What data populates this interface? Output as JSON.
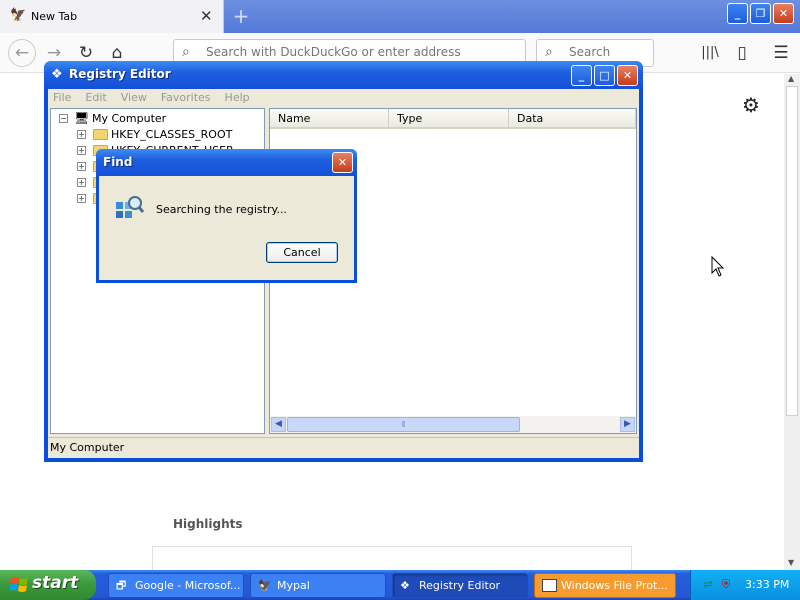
{
  "browser": {
    "tab": {
      "title": "New Tab",
      "close": "✕"
    },
    "new_tab": "+",
    "window_buttons": {
      "minimize": "_",
      "restore": "❐",
      "close": "✕"
    },
    "nav": {
      "back": "←",
      "forward": "→",
      "reload": "↻",
      "home": "⌂"
    },
    "address_placeholder": "Search with DuckDuckGo or enter address",
    "search_placeholder": "Search",
    "library": "|||\\",
    "sidebar": "▯",
    "menu": "☰",
    "gear": "⚙",
    "highlights_heading": "Highlights"
  },
  "registry_editor": {
    "title": "Registry Editor",
    "menu": [
      "File",
      "Edit",
      "View",
      "Favorites",
      "Help"
    ],
    "tree": {
      "root": "My Computer",
      "children": [
        "HKEY_CLASSES_ROOT",
        "HKEY_CURRENT_USER",
        "",
        "",
        ""
      ]
    },
    "columns": [
      "Name",
      "Type",
      "Data"
    ],
    "status": "My Computer"
  },
  "find_dialog": {
    "title": "Find",
    "message": "Searching the registry...",
    "cancel_label": "Cancel",
    "close": "✕"
  },
  "taskbar": {
    "start_label": "start",
    "buttons": [
      {
        "label": "Google - Microsof...",
        "state": "normal"
      },
      {
        "label": "Mypal",
        "state": "normal"
      },
      {
        "label": "Registry Editor",
        "state": "active"
      },
      {
        "label": "Windows File Prot...",
        "state": "flash"
      }
    ],
    "clock": "3:33 PM"
  },
  "colors": {
    "xp_blue": "#245edb",
    "start_green": "#3c9a3c",
    "flash_orange": "#f79b2f",
    "close_red": "#c43c1c"
  }
}
